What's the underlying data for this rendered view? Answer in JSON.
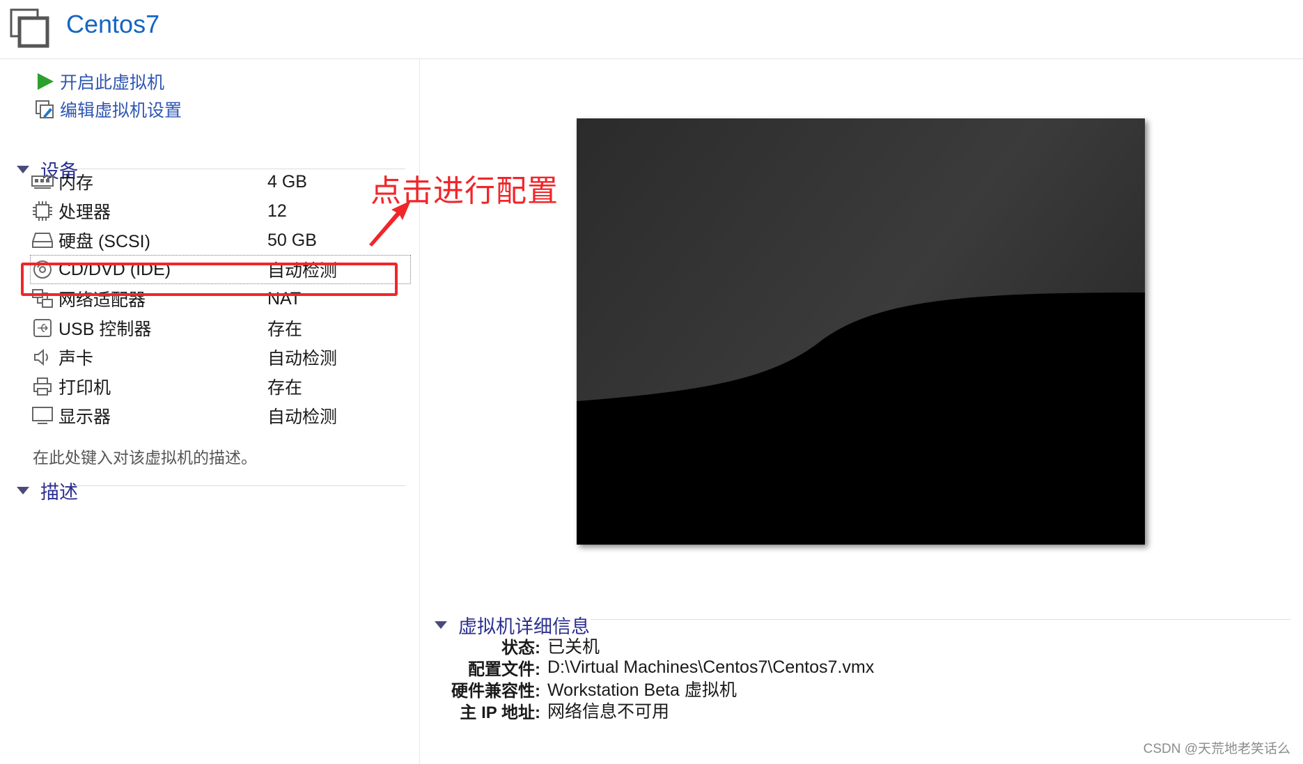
{
  "header": {
    "vm_name": "Centos7"
  },
  "actions": [
    {
      "label": "开启此虚拟机",
      "icon": "play-icon"
    },
    {
      "label": "编辑虚拟机设置",
      "icon": "edit-settings-icon"
    }
  ],
  "devices_section": {
    "title": "设备",
    "items": [
      {
        "name": "内存",
        "value": "4 GB",
        "icon": "memory-icon"
      },
      {
        "name": "处理器",
        "value": "12",
        "icon": "processor-icon"
      },
      {
        "name": "硬盘 (SCSI)",
        "value": "50 GB",
        "icon": "hard-disk-icon"
      },
      {
        "name": "CD/DVD (IDE)",
        "value": "自动检测",
        "icon": "cd-dvd-icon"
      },
      {
        "name": "网络适配器",
        "value": "NAT",
        "icon": "network-adapter-icon"
      },
      {
        "name": "USB 控制器",
        "value": "存在",
        "icon": "usb-icon"
      },
      {
        "name": "声卡",
        "value": "自动检测",
        "icon": "sound-icon"
      },
      {
        "name": "打印机",
        "value": "存在",
        "icon": "printer-icon"
      },
      {
        "name": "显示器",
        "value": "自动检测",
        "icon": "display-icon"
      }
    ]
  },
  "description_section": {
    "title": "描述",
    "placeholder": "在此处键入对该虚拟机的描述。"
  },
  "annotation": {
    "text": "点击进行配置",
    "color": "#f0262a"
  },
  "details_section": {
    "title": "虚拟机详细信息",
    "rows": [
      {
        "key": "状态:",
        "value": "已关机"
      },
      {
        "key": "配置文件:",
        "value": "D:\\Virtual Machines\\Centos7\\Centos7.vmx"
      },
      {
        "key": "硬件兼容性:",
        "value": "Workstation Beta 虚拟机"
      },
      {
        "key": "主 IP 地址:",
        "value": "网络信息不可用"
      }
    ]
  },
  "watermark": "CSDN @天荒地老笑话么"
}
